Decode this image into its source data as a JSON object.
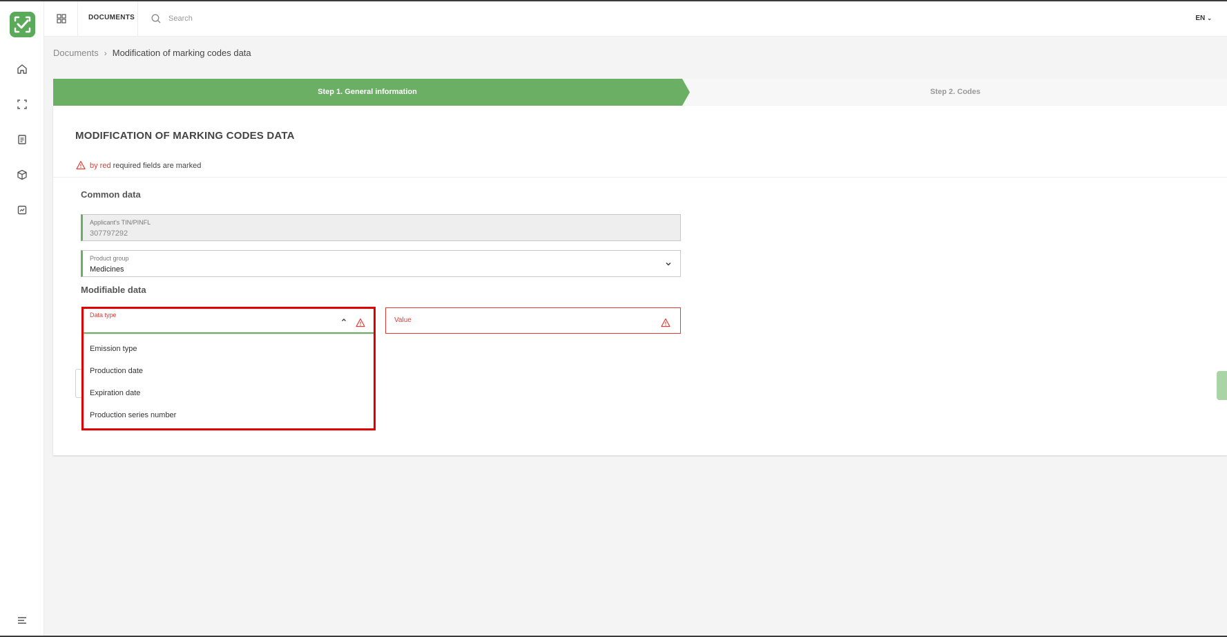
{
  "header": {
    "section_title": "DOCUMENTS",
    "search_placeholder": "Search",
    "language": "EN"
  },
  "breadcrumb": {
    "parent": "Documents",
    "current": "Modification of marking codes data"
  },
  "steps": [
    {
      "label": "Step 1. General information",
      "active": true
    },
    {
      "label": "Step 2. Codes",
      "active": false
    }
  ],
  "form": {
    "title": "MODIFICATION OF MARKING CODES DATA",
    "required_note": {
      "highlight": "by red",
      "rest": " required fields are marked"
    },
    "common_section": "Common data",
    "applicant": {
      "label": "Applicant's TIN/PINFL",
      "value": "307797292"
    },
    "product_group": {
      "label": "Product group",
      "value": "Medicines"
    },
    "modifiable_section": "Modifiable data",
    "data_type": {
      "label": "Data type",
      "options": [
        "Emission type",
        "Production date",
        "Expiration date",
        "Production series number"
      ]
    },
    "value_field": {
      "label": "Value"
    }
  },
  "colors": {
    "brand_green": "#6aaf63",
    "error_red": "#e53935",
    "highlight_red": "#e00000"
  },
  "icons": {
    "sidebar": [
      "home-icon",
      "scan-icon",
      "document-icon",
      "box-icon",
      "report-icon",
      "menu-icon"
    ]
  }
}
